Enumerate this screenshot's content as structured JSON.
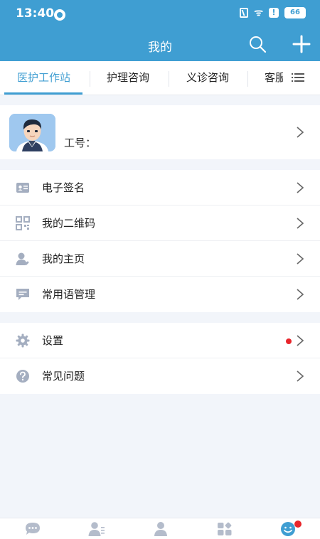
{
  "status_bar": {
    "time": "13:40",
    "battery": "66",
    "wifi": "ᯤ"
  },
  "header": {
    "title": "我的"
  },
  "tabs": [
    {
      "label": "医护工作站",
      "active": true
    },
    {
      "label": "护理咨询",
      "active": false
    },
    {
      "label": "义诊咨询",
      "active": false
    },
    {
      "label": "客服",
      "active": false
    }
  ],
  "profile": {
    "id_label": "工号："
  },
  "menu_group1": [
    {
      "label": "电子签名",
      "icon": "id-card-icon"
    },
    {
      "label": "我的二维码",
      "icon": "qr-code-icon"
    },
    {
      "label": "我的主页",
      "icon": "user-heart-icon"
    },
    {
      "label": "常用语管理",
      "icon": "message-icon"
    }
  ],
  "menu_group2": [
    {
      "label": "设置",
      "icon": "gear-icon",
      "badge": true
    },
    {
      "label": "常见问题",
      "icon": "help-icon"
    }
  ],
  "bottom_nav": [
    {
      "icon": "chat-icon"
    },
    {
      "icon": "contacts-icon"
    },
    {
      "icon": "person-icon"
    },
    {
      "icon": "apps-icon"
    },
    {
      "icon": "smiley-icon",
      "active": true,
      "badge": true
    }
  ],
  "colors": {
    "primary": "#3f9ed2",
    "background": "#f2f5fa",
    "badge": "#e8252b",
    "icon_gray": "#a4aec0"
  }
}
